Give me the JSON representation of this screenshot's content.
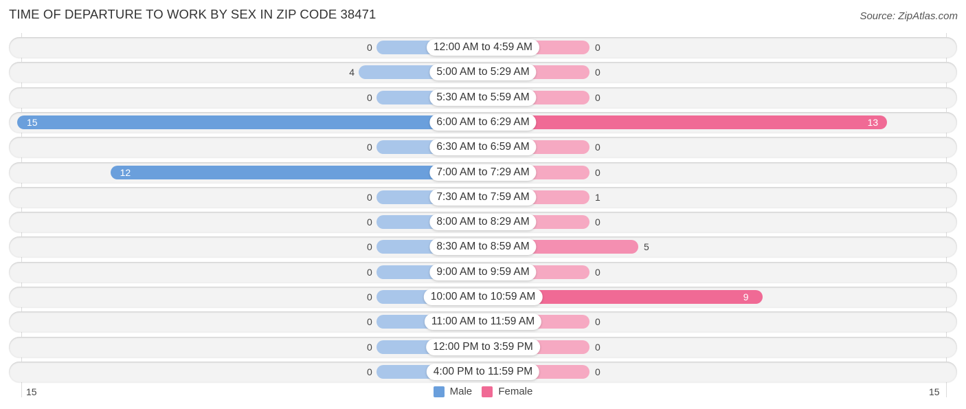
{
  "chart_data": {
    "type": "bar",
    "orientation": "horizontal-diverging",
    "title": "TIME OF DEPARTURE TO WORK BY SEX IN ZIP CODE 38471",
    "source": "Source: ZipAtlas.com",
    "categories": [
      "12:00 AM to 4:59 AM",
      "5:00 AM to 5:29 AM",
      "5:30 AM to 5:59 AM",
      "6:00 AM to 6:29 AM",
      "6:30 AM to 6:59 AM",
      "7:00 AM to 7:29 AM",
      "7:30 AM to 7:59 AM",
      "8:00 AM to 8:29 AM",
      "8:30 AM to 8:59 AM",
      "9:00 AM to 9:59 AM",
      "10:00 AM to 10:59 AM",
      "11:00 AM to 11:59 AM",
      "12:00 PM to 3:59 PM",
      "4:00 PM to 11:59 PM"
    ],
    "series": [
      {
        "name": "Male",
        "color": "#6a9fdc",
        "values": [
          0,
          4,
          0,
          15,
          0,
          12,
          0,
          0,
          0,
          0,
          0,
          0,
          0,
          0
        ]
      },
      {
        "name": "Female",
        "color": "#f06a95",
        "values": [
          0,
          0,
          0,
          13,
          0,
          0,
          1,
          0,
          5,
          0,
          9,
          0,
          0,
          0
        ]
      }
    ],
    "xlim": [
      -15,
      15
    ],
    "axis_ticks": {
      "left": "15",
      "right": "15"
    },
    "legend": {
      "position": "bottom-center",
      "items": [
        "Male",
        "Female"
      ]
    },
    "grid": false
  }
}
